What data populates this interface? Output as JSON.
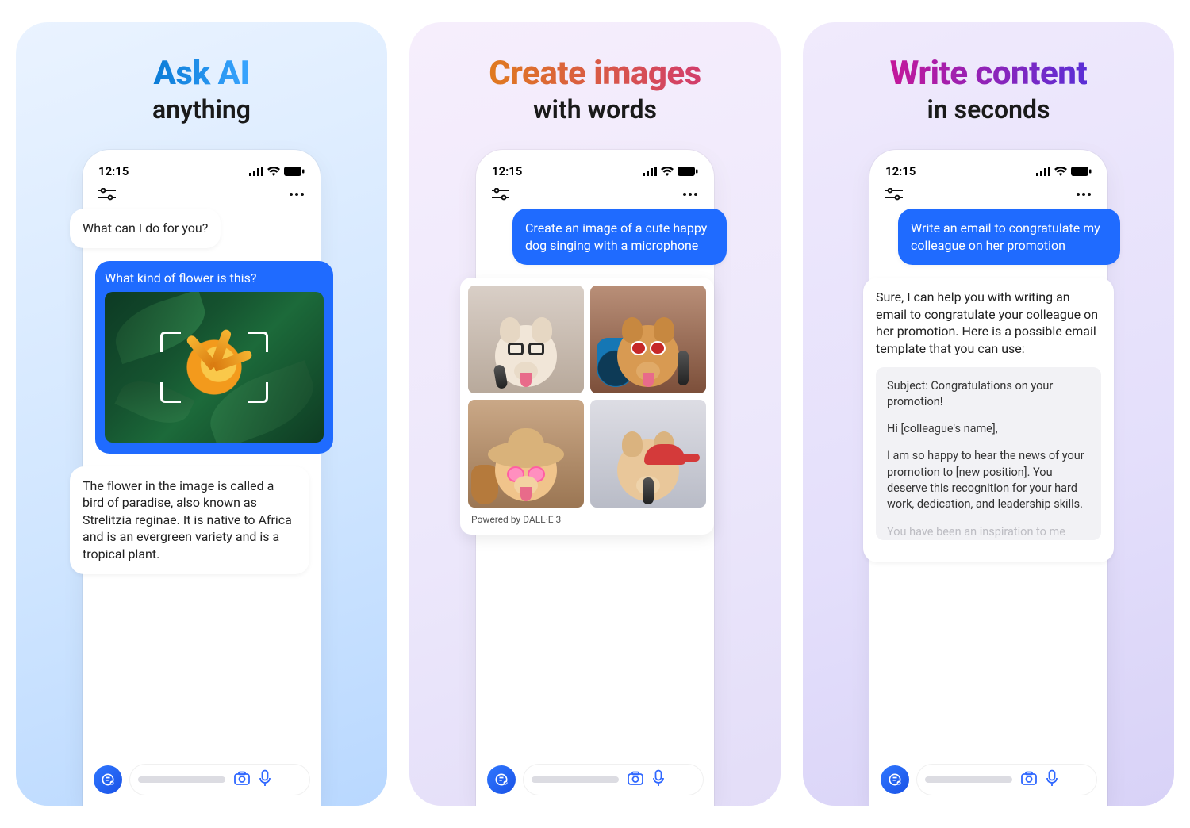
{
  "panels": [
    {
      "title": "Ask AI",
      "subtitle": "anything",
      "status_time": "12:15",
      "ai_greeting": "What can I do for you?",
      "user_caption": "What kind of flower is this?",
      "ai_answer": "The flower in the image is called a bird of paradise, also known as Strelitzia reginae. It is native to Africa and is an evergreen variety and is a tropical plant."
    },
    {
      "title": "Create images",
      "subtitle": "with words",
      "status_time": "12:15",
      "user_prompt": "Create an image of a cute happy dog singing with a microphone",
      "powered_by": "Powered by DALL·E 3"
    },
    {
      "title": "Write content",
      "subtitle": "in seconds",
      "status_time": "12:15",
      "user_prompt": "Write an email to congratulate my colleague on her promotion",
      "ai_intro": "Sure, I can help you with writing an email to congratulate your colleague on her promotion. Here is a possible email template that you can use:",
      "email_subject": "Subject: Congratulations on your promotion!",
      "email_greeting": "Hi [colleague's name],",
      "email_body1": "I am so happy to hear the news of your promotion to [new position]. You deserve this recognition for your hard work, dedication, and leadership skills.",
      "email_body2": "You have been an inspiration to me"
    }
  ]
}
